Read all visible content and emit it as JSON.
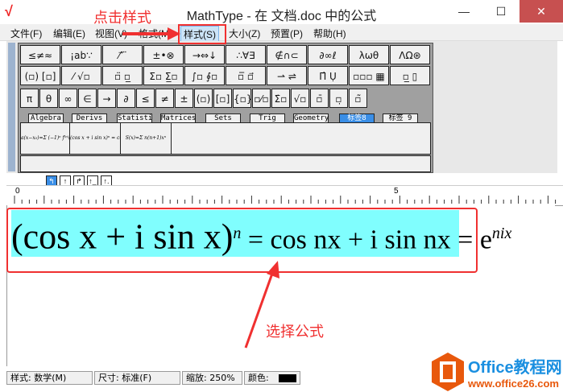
{
  "window": {
    "title": "MathType - 在 文档.doc 中的公式",
    "minimize": "—",
    "maximize": "☐",
    "close": "✕"
  },
  "menu": [
    "文件(F)",
    "编辑(E)",
    "视图(V)",
    "格式(M)",
    "样式(S)",
    "大小(Z)",
    "预置(P)",
    "帮助(H)"
  ],
  "palette": {
    "row1": [
      "≤≠≈",
      "¡ab∵",
      "⁄ ⃗ ⃛",
      "±•⊗",
      "→⇔↓",
      "∴∀∃",
      "∉∩⊂",
      "∂∞ℓ",
      "λωθ",
      "ΛΩ⊛"
    ],
    "row2": [
      "(▫) [▫]",
      "⁄ √▫",
      "▫̈ ▫̲",
      "Σ▫ Σ̲▫",
      "∫▫ ∮▫",
      "▫̅ ▫⃗",
      "⇀ ⇌",
      "Π̂ Ụ",
      "▫▫▫ ▦",
      "▫̲ ▯"
    ],
    "row3": [
      "π",
      "θ",
      "∞",
      "∈",
      "→",
      "∂",
      "≤",
      "≠",
      "±",
      "(▫)",
      "[▫]",
      "{▫}",
      "▫⁄▫",
      "Σ̇▫",
      "√▫",
      "▫̄",
      "▫̣",
      "▫̃"
    ],
    "tabs": [
      "Algebra",
      "Derivs",
      "Statisti",
      "Matrices",
      "Sets",
      "Trig",
      "Geometry",
      "标签8",
      "标签 9"
    ],
    "templates": [
      "a(x−x₀)=Σ (−1)ⁿ f⁽ⁿ⁾(x−x)",
      "(cos x + i sin x)ⁿ = cos",
      "S(x)=Σ n(n+1)xⁿ"
    ]
  },
  "nudge": [
    "↰",
    "↑",
    "↱",
    "↑_",
    "↑."
  ],
  "ruler": {
    "labels": [
      "0",
      "5"
    ]
  },
  "equation": {
    "base": "(cos x + i sin x)",
    "exp_n": "n",
    "rhs": " = cos nx + i sin nx = e",
    "exp_nix": "nix"
  },
  "annotations": {
    "click_style": "点击样式",
    "select_formula": "选择公式"
  },
  "status": {
    "style": "样式: 数学(M)",
    "size": "尺寸: 标准(F)",
    "zoom": "缩放: 250%",
    "color": "颜色:",
    "color_value": "#000000"
  },
  "watermark": {
    "brand": "Office教程网",
    "url": "www.office26.com"
  }
}
